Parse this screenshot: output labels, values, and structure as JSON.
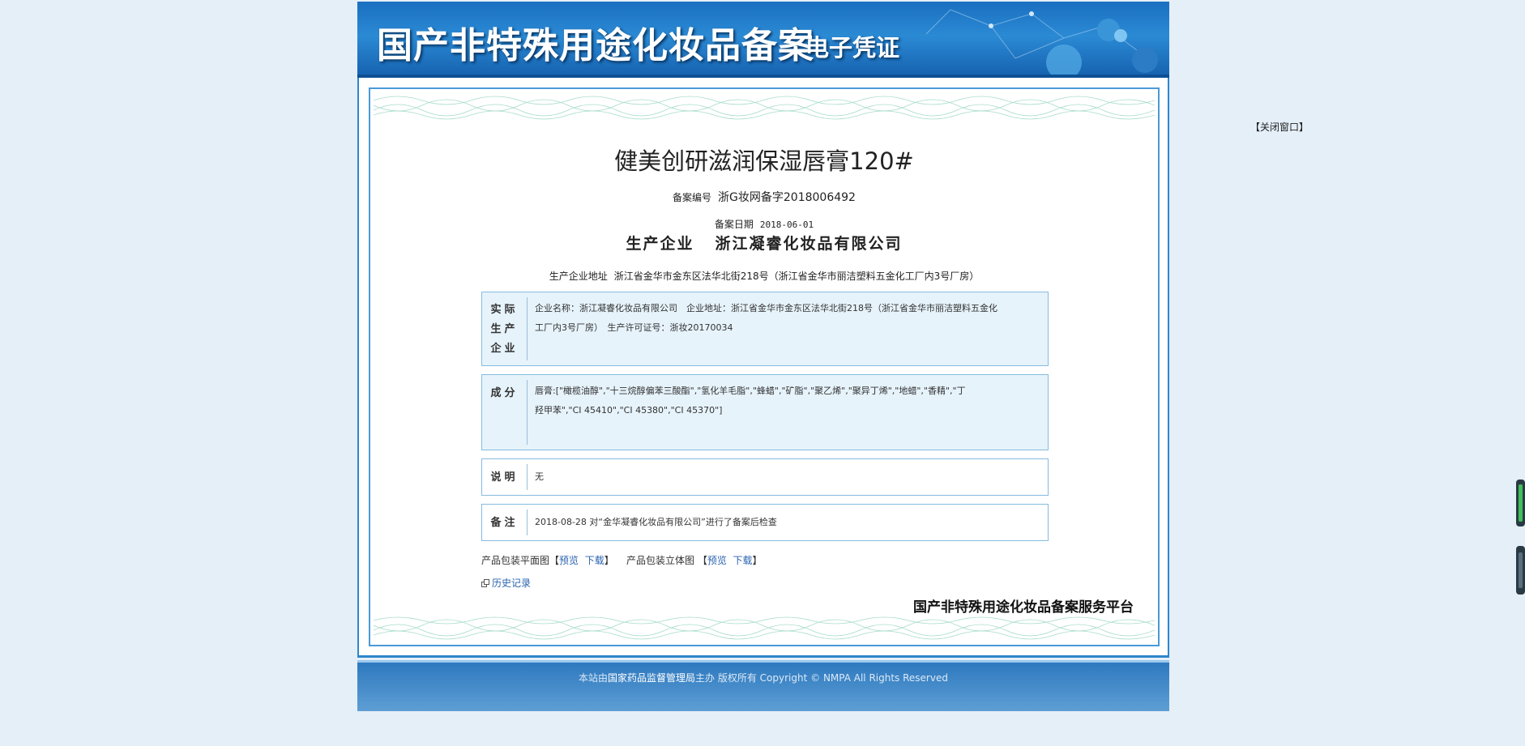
{
  "banner": {
    "title": "国产非特殊用途化妆品备案",
    "subtitle": "电子凭证"
  },
  "certificate": {
    "product_name": "健美创研滋润保湿唇膏120#",
    "registration": {
      "label": "备案编号",
      "value": "浙G妆网备字2018006492"
    },
    "date": {
      "label": "备案日期",
      "value": "2018-06-01"
    },
    "manufacturer": {
      "label": "生产企业",
      "value": "浙江凝睿化妆品有限公司"
    },
    "address": {
      "label": "生产企业地址",
      "value": "浙江省金华市金东区法华北街218号（浙江省金华市丽洁塑料五金化工厂内3号厂房）"
    },
    "sections": {
      "actual_producer": {
        "label": "实际生产企业",
        "label_lines": [
          "实际",
          "生产",
          "企业"
        ],
        "text_line1": "企业名称：浙江凝睿化妆品有限公司　企业地址：浙江省金华市金东区法华北街218号（浙江省金华市丽洁塑料五金化",
        "text_line2": "工厂内3号厂房）　生产许可证号：浙妆20170034"
      },
      "ingredients": {
        "label": "成分",
        "text_line1": "唇膏:[\"橄榄油醇\",\"十三烷醇偏苯三酸酯\",\"氢化羊毛脂\",\"蜂蜡\",\"矿脂\",\"聚乙烯\",\"聚异丁烯\",\"地蜡\",\"香精\",\"丁",
        "text_line2": "羟甲苯\",\"CI 45410\",\"CI 45380\",\"CI 45370\"]"
      },
      "notes": {
        "label": "说明",
        "text": "无"
      },
      "remarks": {
        "label": "备注",
        "text": "2018-08-28 对“金华凝睿化妆品有限公司”进行了备案后检查"
      }
    },
    "package_links": {
      "flat_label": "产品包装平面图",
      "solid_label": "产品包装立体图",
      "preview": "预览",
      "download": "下载",
      "bracket_open": "【",
      "bracket_close": "】"
    },
    "history": "历史记录",
    "platform": "国产非特殊用途化妆品备案服务平台"
  },
  "footer": {
    "prefix": "本站由",
    "agency": "国家药品监督管理局",
    "suffix": "主办 版权所有 Copyright © NMPA All Rights Reserved"
  },
  "close_window": "【关闭窗口】"
}
